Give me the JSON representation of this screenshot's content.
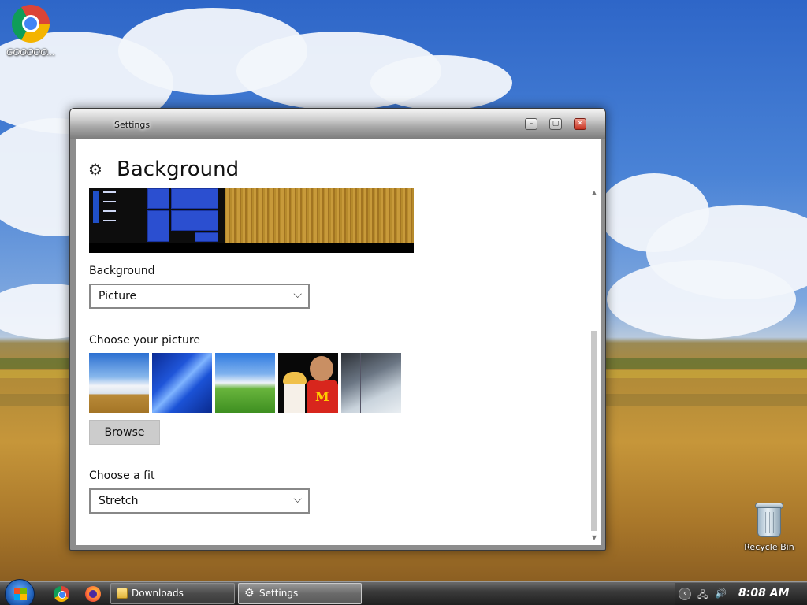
{
  "desktop": {
    "icons": [
      {
        "label": "GOOOOO...",
        "icon": "chrome-icon"
      },
      {
        "label": "Recycle Bin",
        "icon": "recycle-bin-icon"
      }
    ]
  },
  "window": {
    "title": "Settings",
    "controls": {
      "minimize": "–",
      "maximize": "▢",
      "close": "✕"
    },
    "page_title": "Background",
    "background_label": "Background",
    "background_value": "Picture",
    "choose_picture_label": "Choose your picture",
    "browse_label": "Browse",
    "choose_fit_label": "Choose a fit",
    "fit_value": "Stretch",
    "thumbnails": [
      "field-clouds",
      "blue-light",
      "bliss-hill",
      "cartoon-mcdonalds",
      "glass-building"
    ]
  },
  "taskbar": {
    "tasks": [
      {
        "label": "Downloads",
        "icon": "folder-icon"
      },
      {
        "label": "Settings",
        "icon": "gear-icon",
        "active": true
      }
    ],
    "tray": {
      "time": "8:08 AM"
    }
  },
  "colors": {
    "accent": "#2b4fd0",
    "taskbar": "#2a2a2a",
    "close_button": "#c6301f"
  }
}
